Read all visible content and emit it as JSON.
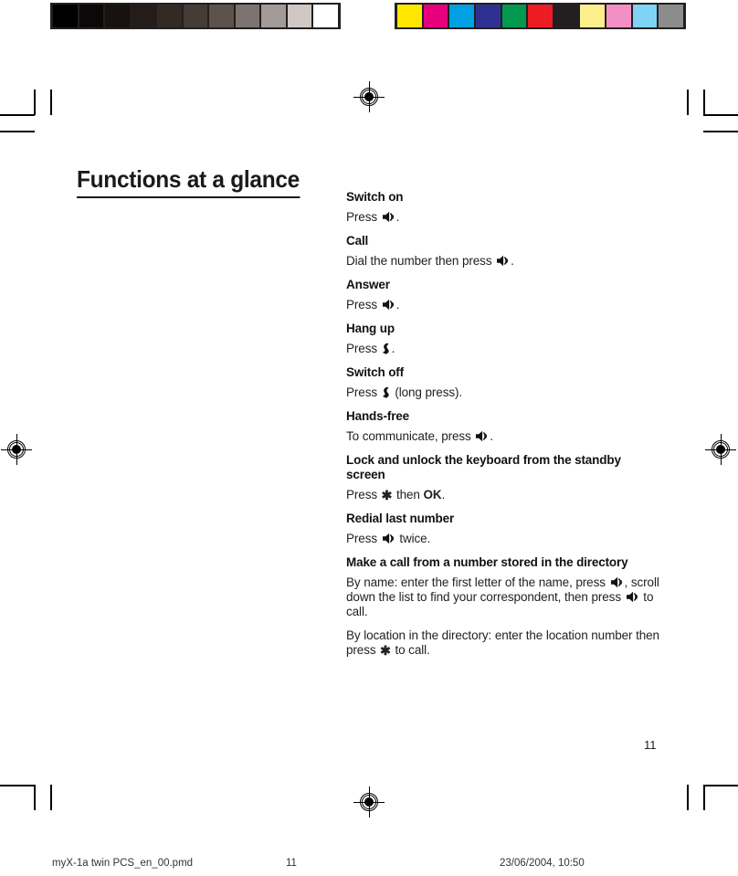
{
  "calibration": {
    "grayscale_label": "grayscale-calibration-bar",
    "grayscale_swatches": [
      "#000000",
      "#0b0807",
      "#17110f",
      "#241c19",
      "#332a26",
      "#463c37",
      "#5e524d",
      "#7d7370",
      "#a39b98",
      "#cfc8c5",
      "#ffffff"
    ],
    "color_label": "color-calibration-bar",
    "color_swatches": [
      "#ffe800",
      "#e6007e",
      "#00a0e3",
      "#2e3192",
      "#00994d",
      "#ed1c24",
      "#231f20",
      "#fdee8c",
      "#f48fc6",
      "#7fd4f5",
      "#8c8c8c"
    ]
  },
  "page": {
    "title": "Functions at a glance",
    "number": "11"
  },
  "icons": {
    "call_key": "green-call-key-icon",
    "hangup_key": "red-hangup-key-icon",
    "star_key": "✱"
  },
  "entries": [
    {
      "heading": "Switch on",
      "body_parts": [
        {
          "t": "text",
          "v": "Press "
        },
        {
          "t": "icon",
          "v": "call_key"
        },
        {
          "t": "text",
          "v": "."
        }
      ]
    },
    {
      "heading": "Call",
      "body_parts": [
        {
          "t": "text",
          "v": "Dial the number then press "
        },
        {
          "t": "icon",
          "v": "call_key"
        },
        {
          "t": "text",
          "v": "."
        }
      ]
    },
    {
      "heading": "Answer",
      "body_parts": [
        {
          "t": "text",
          "v": "Press "
        },
        {
          "t": "icon",
          "v": "call_key"
        },
        {
          "t": "text",
          "v": "."
        }
      ]
    },
    {
      "heading": "Hang up",
      "body_parts": [
        {
          "t": "text",
          "v": "Press "
        },
        {
          "t": "icon",
          "v": "hangup_key"
        },
        {
          "t": "text",
          "v": "."
        }
      ]
    },
    {
      "heading": "Switch off",
      "body_parts": [
        {
          "t": "text",
          "v": "Press "
        },
        {
          "t": "icon",
          "v": "hangup_key"
        },
        {
          "t": "text",
          "v": " (long press)."
        }
      ]
    },
    {
      "heading": "Hands-free",
      "body_parts": [
        {
          "t": "text",
          "v": "To communicate, press "
        },
        {
          "t": "icon",
          "v": "call_key"
        },
        {
          "t": "text",
          "v": "."
        }
      ]
    },
    {
      "heading": "Lock and unlock the keyboard from the standby screen",
      "body_parts": [
        {
          "t": "text",
          "v": "Press "
        },
        {
          "t": "star",
          "v": "✱"
        },
        {
          "t": "text",
          "v": " then "
        },
        {
          "t": "bold",
          "v": "OK"
        },
        {
          "t": "text",
          "v": "."
        }
      ]
    },
    {
      "heading": "Redial last number",
      "body_parts": [
        {
          "t": "text",
          "v": "Press "
        },
        {
          "t": "icon",
          "v": "call_key"
        },
        {
          "t": "text",
          "v": " twice."
        }
      ]
    },
    {
      "heading": "Make a call from a number stored in the directory",
      "body_parts": [
        {
          "t": "text",
          "v": "By name: enter the first letter of the name, press "
        },
        {
          "t": "icon",
          "v": "call_key"
        },
        {
          "t": "text",
          "v": ", scroll down the list to find your correspondent, then press "
        },
        {
          "t": "icon",
          "v": "call_key"
        },
        {
          "t": "text",
          "v": " to call."
        }
      ],
      "body2_parts": [
        {
          "t": "text",
          "v": "By location in the directory: enter the location number then press "
        },
        {
          "t": "star",
          "v": "✱"
        },
        {
          "t": "text",
          "v": " to call."
        }
      ]
    }
  ],
  "footer": {
    "file_name": "myX-1a twin PCS_en_00.pmd",
    "page_number": "11",
    "timestamp": "23/06/2004, 10:50"
  }
}
